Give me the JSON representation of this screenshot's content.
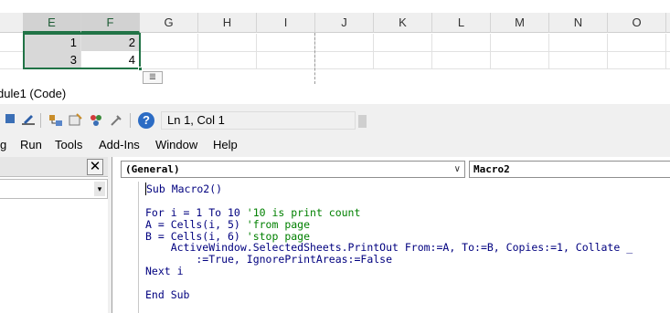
{
  "excel": {
    "columns": [
      {
        "label": "E",
        "selected": true
      },
      {
        "label": "F",
        "selected": true
      },
      {
        "label": "G",
        "selected": false
      },
      {
        "label": "H",
        "selected": false
      },
      {
        "label": "I",
        "selected": false
      },
      {
        "label": "J",
        "selected": false
      },
      {
        "label": "K",
        "selected": false
      },
      {
        "label": "L",
        "selected": false
      },
      {
        "label": "M",
        "selected": false
      },
      {
        "label": "N",
        "selected": false
      },
      {
        "label": "O",
        "selected": false
      }
    ],
    "rows": [
      [
        "1",
        "2"
      ],
      [
        "3",
        "4"
      ]
    ],
    "selection_color": "#217346"
  },
  "vbe": {
    "title": "dule1 (Code)",
    "toolbar": {
      "position_text": "Ln 1, Col 1",
      "help_icon": "?"
    },
    "menu": [
      "g",
      "Run",
      "Tools",
      "Add-Ins",
      "Window",
      "Help"
    ],
    "pane_close": "✕",
    "object_combo": "(General)",
    "procedure_combo": "Macro2",
    "code": [
      {
        "code": "Sub Macro2()",
        "comment": ""
      },
      {
        "code": "",
        "comment": ""
      },
      {
        "code": "For i = 1 To 10 ",
        "comment": "'10 is print count"
      },
      {
        "code": "A = Cells(i, 5) ",
        "comment": "'from page"
      },
      {
        "code": "B = Cells(i, 6) ",
        "comment": "'stop page"
      },
      {
        "code": "    ActiveWindow.SelectedSheets.PrintOut From:=A, To:=B, Copies:=1, Collate _",
        "comment": ""
      },
      {
        "code": "        :=True, IgnorePrintAreas:=False",
        "comment": ""
      },
      {
        "code": "Next i",
        "comment": ""
      },
      {
        "code": "",
        "comment": ""
      },
      {
        "code": "End Sub",
        "comment": ""
      }
    ],
    "comment_color": "#008000",
    "keyword_color": "#00007f"
  }
}
